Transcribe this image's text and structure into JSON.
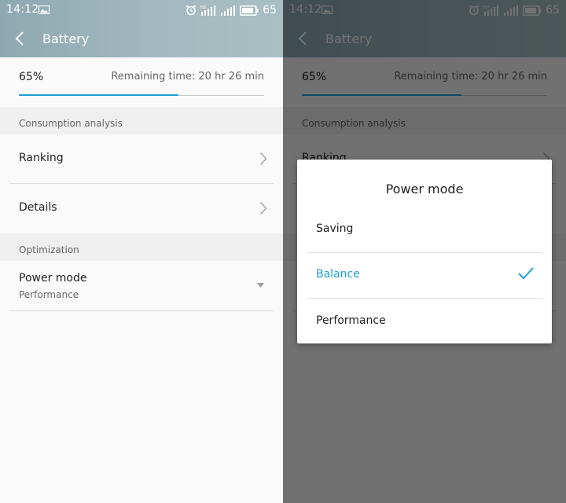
{
  "colors": {
    "accent": "#1e9ed8",
    "header": "#a3b8bf",
    "overlay": "rgba(0,0,0,0.55)"
  },
  "status_bar": {
    "time": "14:12",
    "battery_level": "65",
    "icons": [
      "image-icon",
      "alarm-icon",
      "hd-signal-icon",
      "signal-icon",
      "battery-icon"
    ]
  },
  "nav": {
    "title": "Battery"
  },
  "battery": {
    "percent": "65%",
    "remaining": "Remaining time: 20 hr 26 min",
    "level_fraction": 0.65
  },
  "sections": {
    "consumption": "Consumption analysis",
    "optimization": "Optimization"
  },
  "items": {
    "ranking": "Ranking",
    "details": "Details",
    "power_mode": {
      "label": "Power mode",
      "value": "Performance"
    }
  },
  "dialog": {
    "title": "Power mode",
    "options": [
      {
        "label": "Saving"
      },
      {
        "label": "Balance",
        "selected": true
      },
      {
        "label": "Performance"
      }
    ]
  }
}
